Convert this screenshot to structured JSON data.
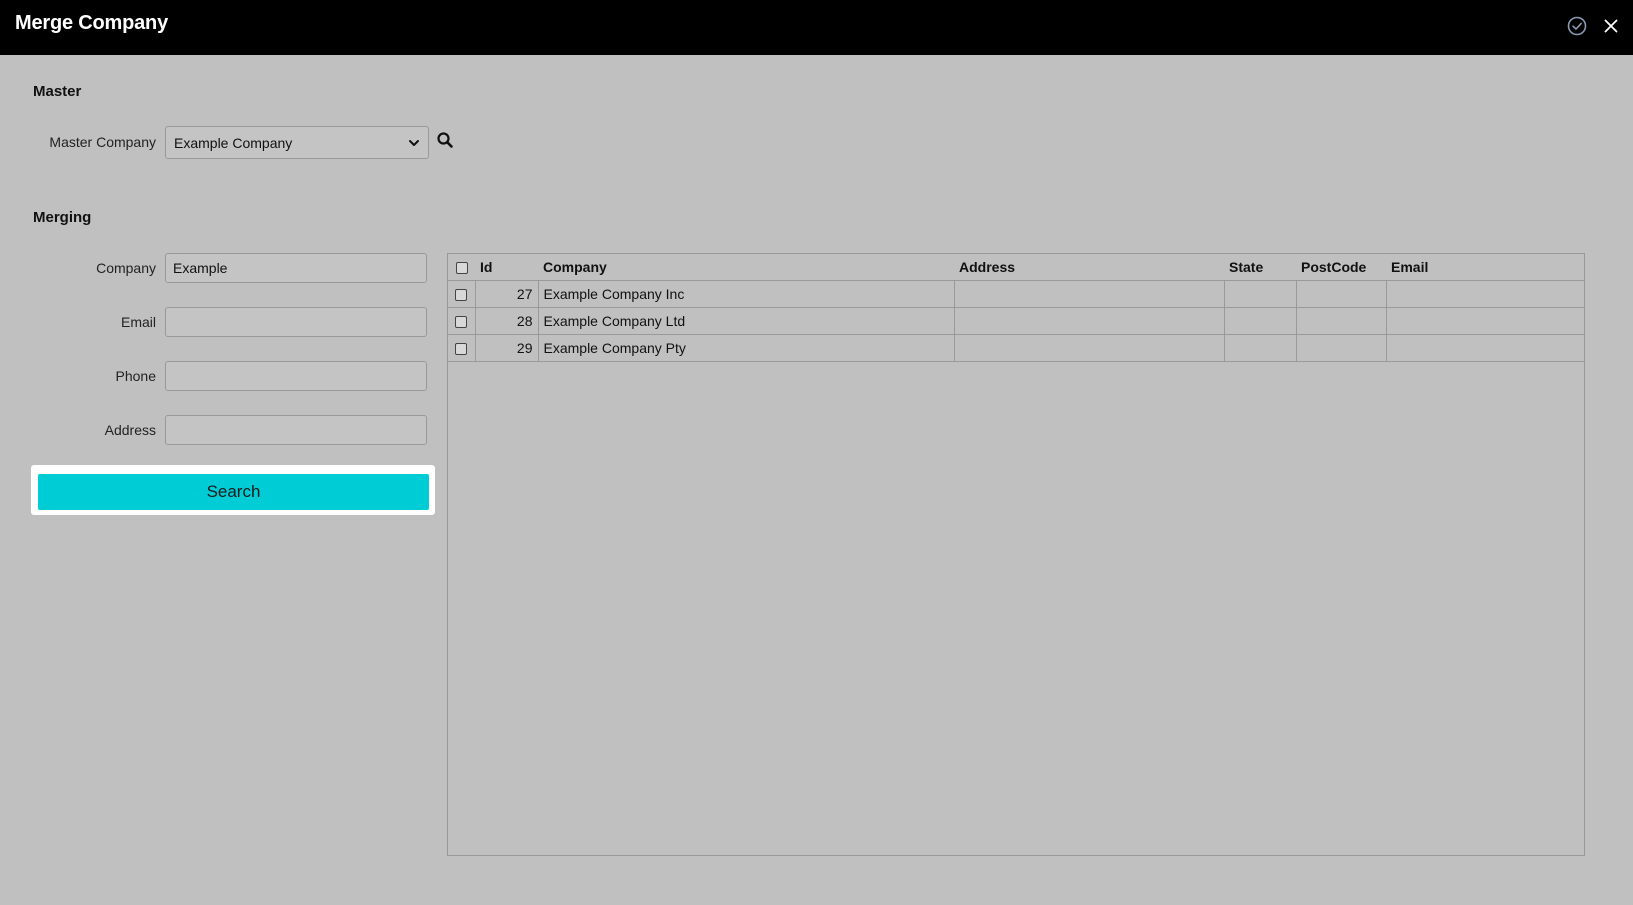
{
  "window": {
    "title": "Merge Company",
    "confirm_icon": "check-circle-icon",
    "close_icon": "close-icon"
  },
  "master": {
    "section_title": "Master",
    "company_label": "Master Company",
    "company_value": "Example Company"
  },
  "merging": {
    "section_title": "Merging",
    "fields": {
      "company": {
        "label": "Company",
        "value": "Example"
      },
      "email": {
        "label": "Email",
        "value": ""
      },
      "phone": {
        "label": "Phone",
        "value": ""
      },
      "address": {
        "label": "Address",
        "value": ""
      }
    },
    "search_label": "Search"
  },
  "table": {
    "columns": [
      "Id",
      "Company",
      "Address",
      "State",
      "PostCode",
      "Email"
    ],
    "rows": [
      {
        "id": "27",
        "company": "Example Company Inc",
        "address": "",
        "state": "",
        "postcode": "",
        "email": ""
      },
      {
        "id": "28",
        "company": "Example Company Ltd",
        "address": "",
        "state": "",
        "postcode": "",
        "email": ""
      },
      {
        "id": "29",
        "company": "Example Company Pty",
        "address": "",
        "state": "",
        "postcode": "",
        "email": ""
      }
    ]
  },
  "colors": {
    "titlebar": "#000000",
    "background": "#c0c0c0",
    "accent": "#00ccd6"
  }
}
